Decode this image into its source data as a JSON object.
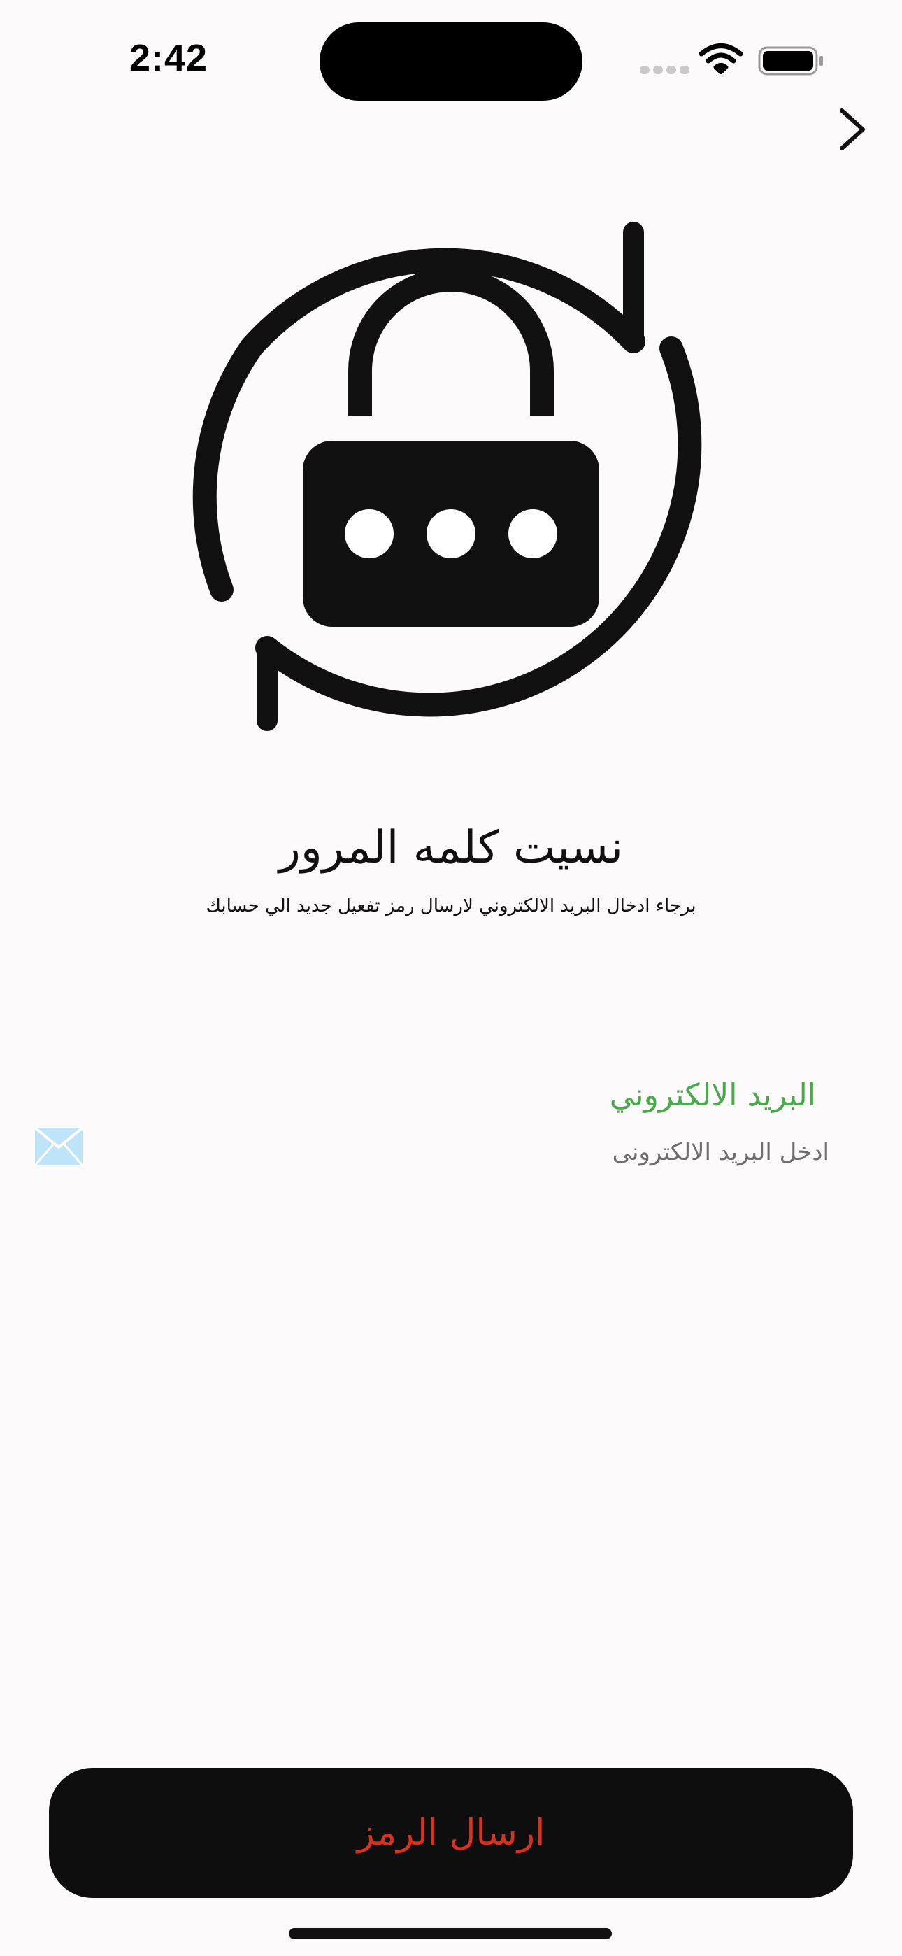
{
  "status_bar": {
    "time": "2:42"
  },
  "header": {
    "back_icon": "chevron-right-icon"
  },
  "hero": {
    "icon": "lock-reset-icon"
  },
  "title": "نسيت كلمه المرور",
  "subtitle": "برجاء ادخال البريد الالكتروني لارسال رمز تفعيل جديد الي حسابك",
  "email": {
    "label": "البريد الالكتروني",
    "placeholder": "ادخل البريد الالكترونى",
    "value": "",
    "icon": "envelope-icon"
  },
  "submit": {
    "label": "ارسال الرمز"
  },
  "colors": {
    "background": "#fdfafb",
    "label_green": "#49a84a",
    "button_bg": "#0e0e0e",
    "button_text": "#d7321f",
    "envelope": "#bfe4f8"
  }
}
